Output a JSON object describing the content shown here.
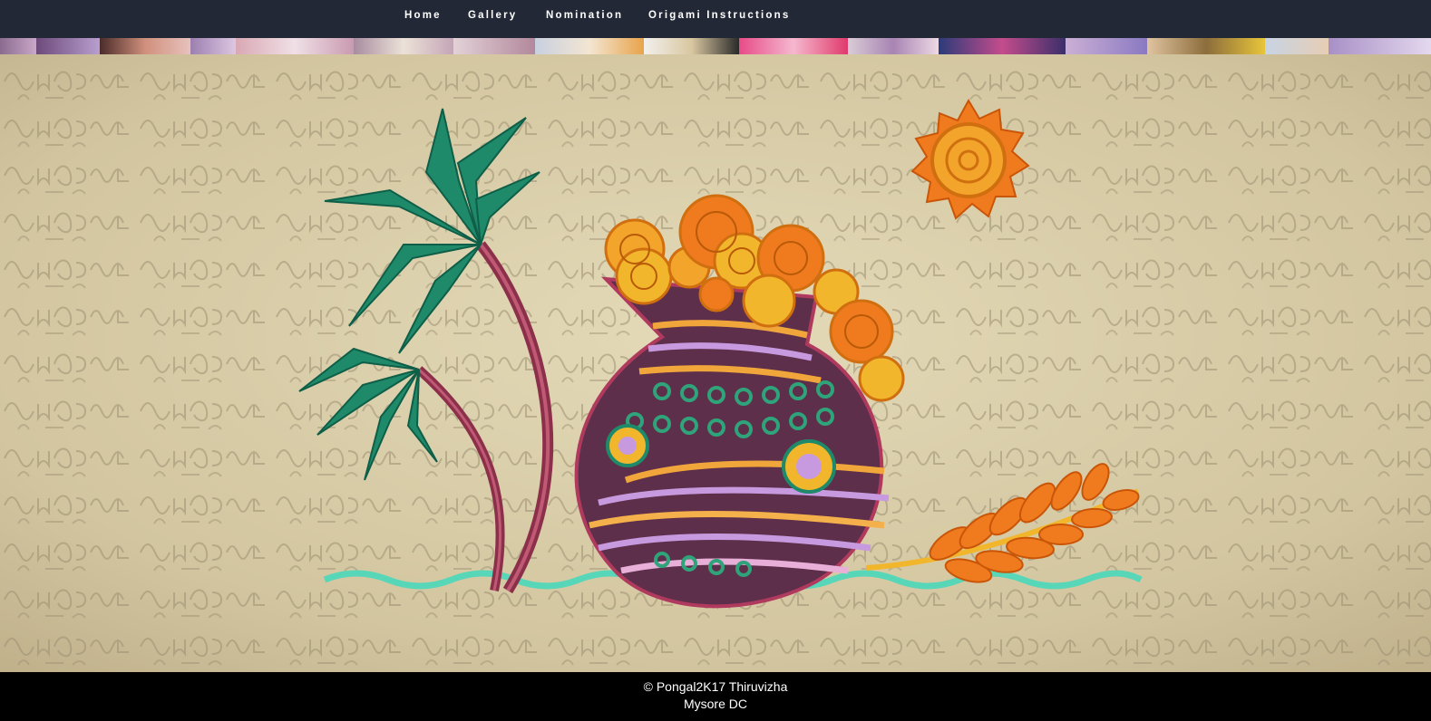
{
  "nav": {
    "items": [
      {
        "label": "Home"
      },
      {
        "label": "Gallery"
      },
      {
        "label": "Nomination"
      },
      {
        "label": "Origami Instructions"
      }
    ]
  },
  "hero": {
    "description_icons": [
      "palm-tree-icon",
      "pongal-pot-icon",
      "sun-icon",
      "wheat-icon"
    ]
  },
  "footer": {
    "line1": "© Pongal2K17 Thiruvizha",
    "line2": "Mysore DC"
  },
  "colors": {
    "navbar_bg": "#222835",
    "page_bg": "#000000",
    "text": "#ffffff",
    "paper_bg": "#d4c7a1",
    "accent_orange": "#f07a1e",
    "accent_gold": "#f2b62c",
    "accent_green": "#1f8a6a"
  }
}
